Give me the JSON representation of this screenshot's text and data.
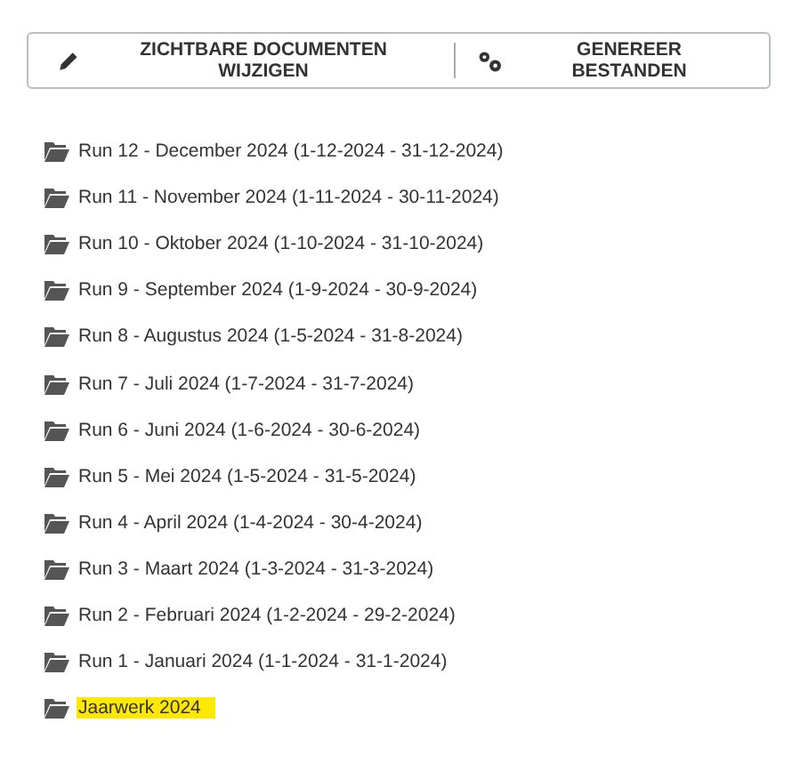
{
  "toolbar": [
    {
      "kind": "edit",
      "label": "ZICHTBARE DOCUMENTEN WIJZIGEN"
    },
    {
      "kind": "generate",
      "label": "GENEREER BESTANDEN"
    }
  ],
  "folders": [
    {
      "label": "Run 12 - December 2024 (1-12-2024 - 31-12-2024)",
      "selected": false
    },
    {
      "label": "Run 11 - November 2024 (1-11-2024 - 30-11-2024)",
      "selected": false
    },
    {
      "label": "Run 10 - Oktober 2024 (1-10-2024 - 31-10-2024)",
      "selected": false
    },
    {
      "label": "Run 9 - September 2024 (1-9-2024 - 30-9-2024)",
      "selected": false
    },
    {
      "label": "Run 8 - Augustus 2024 (1-5-2024 - 31-8-2024)",
      "selected": false
    },
    {
      "label": "Run 7 - Juli 2024 (1-7-2024 - 31-7-2024)",
      "selected": false
    },
    {
      "label": "Run 6 - Juni 2024 (1-6-2024 - 30-6-2024)",
      "selected": false
    },
    {
      "label": "Run 5 - Mei 2024 (1-5-2024 - 31-5-2024)",
      "selected": false
    },
    {
      "label": "Run 4 - April 2024 (1-4-2024 - 30-4-2024)",
      "selected": false
    },
    {
      "label": "Run 3 - Maart 2024 (1-3-2024 - 31-3-2024)",
      "selected": false
    },
    {
      "label": "Run 2 - Februari 2024 (1-2-2024 - 29-2-2024)",
      "selected": false
    },
    {
      "label": "Run 1 - Januari 2024 (1-1-2024 - 31-1-2024)",
      "selected": false
    },
    {
      "label": "Jaarwerk 2024",
      "selected": true
    }
  ]
}
